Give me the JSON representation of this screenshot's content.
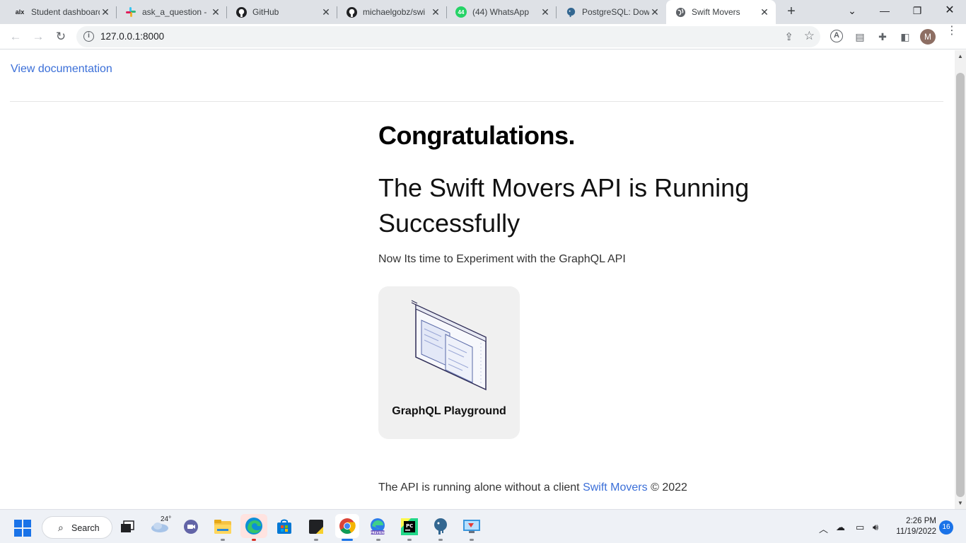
{
  "browser": {
    "tabs": [
      {
        "title": "Student dashboard",
        "favicon": "alx-icon",
        "fav_text": "alx",
        "fav_color": "#e0403a",
        "active": false
      },
      {
        "title": "ask_a_question - ",
        "favicon": "slack-icon",
        "fav_text": "",
        "fav_color": "#4a154b",
        "active": false
      },
      {
        "title": "GitHub",
        "favicon": "github-icon",
        "fav_text": "",
        "fav_color": "#202124",
        "active": false
      },
      {
        "title": "michaelgobz/swi",
        "favicon": "github-icon",
        "fav_text": "",
        "fav_color": "#202124",
        "active": false
      },
      {
        "title": "(44) WhatsApp",
        "favicon": "whatsapp-icon",
        "fav_text": "44",
        "fav_color": "#25d366",
        "active": false
      },
      {
        "title": "PostgreSQL: Dow",
        "favicon": "postgresql-icon",
        "fav_text": "",
        "fav_color": "#336791",
        "active": false
      },
      {
        "title": "Swift Movers",
        "favicon": "globe-icon",
        "fav_text": "",
        "fav_color": "#5f6368",
        "active": true
      }
    ],
    "address": {
      "url": "127.0.0.1:8000"
    },
    "profile_initial": "M"
  },
  "page": {
    "doc_link": "View documentation",
    "heading": "Congratulations.",
    "subheading": "The Swift Movers API is Running Successfully",
    "tagline": "Now Its time to Experiment with the GraphQL API",
    "card_label": "GraphQL Playground",
    "footer_text": "The API is running alone without a client ",
    "footer_link": "Swift Movers",
    "footer_copyright": " © 2022",
    "link_color": "#3b6fd8"
  },
  "taskbar": {
    "search_label": "Search",
    "weather_temp": "24°",
    "time": "2:26 PM",
    "date": "11/19/2022",
    "notification_count": "16",
    "apps": [
      {
        "name": "task-view-icon"
      },
      {
        "name": "weather-icon"
      },
      {
        "name": "teams-chat-icon"
      },
      {
        "name": "file-explorer-icon"
      },
      {
        "name": "edge-icon"
      },
      {
        "name": "microsoft-store-icon"
      },
      {
        "name": "sticky-notes-icon"
      },
      {
        "name": "chrome-icon"
      },
      {
        "name": "edge-preview-icon"
      },
      {
        "name": "pycharm-icon"
      },
      {
        "name": "pgadmin-icon"
      },
      {
        "name": "remote-desktop-icon"
      }
    ]
  }
}
